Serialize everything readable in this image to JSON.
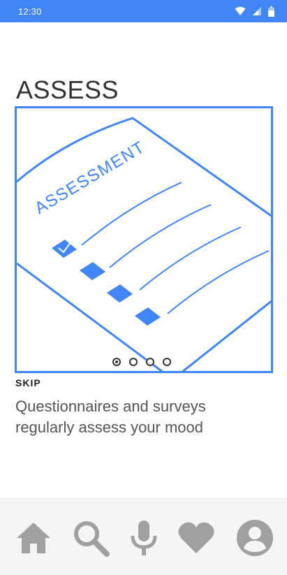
{
  "status_bar": {
    "time": "12:30",
    "icons": [
      "wifi-icon",
      "cell-signal-icon",
      "battery-icon"
    ],
    "background_color": "#4285f4"
  },
  "page": {
    "title": "ASSESS",
    "illustration_label": "ASSESSMENT",
    "skip_label": "SKIP",
    "description_line1": "Questionnaires and surveys",
    "description_line2": "regularly assess your mood"
  },
  "pager": {
    "total": 4,
    "current": 1
  },
  "bottom_nav": {
    "items": [
      "home-icon",
      "search-icon",
      "microphone-icon",
      "heart-icon",
      "profile-icon"
    ]
  },
  "colors": {
    "accent": "#4285f4",
    "nav_icon": "#a0a0a0",
    "text": "#333333"
  }
}
